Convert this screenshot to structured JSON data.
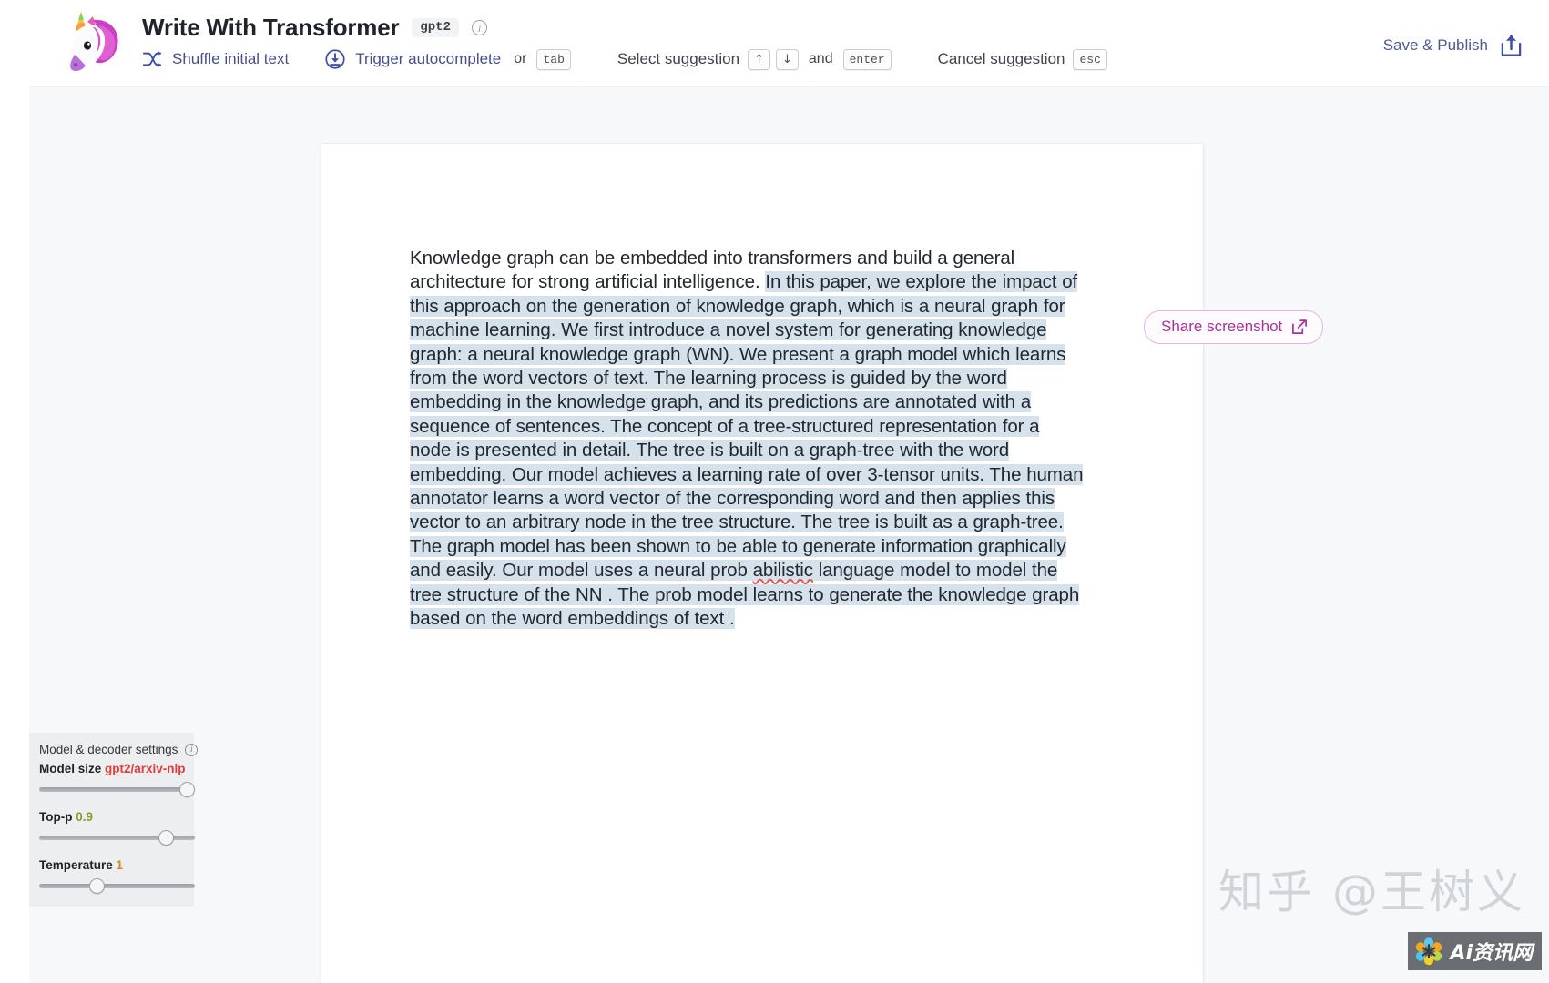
{
  "header": {
    "logo_icon": "unicorn-logo",
    "title": "Write With Transformer",
    "model_badge": "gpt2",
    "info_icon": "info-icon",
    "hints": [
      {
        "icon": "shuffle-icon",
        "label": "Shuffle initial text",
        "keys": []
      },
      {
        "icon": "download-icon",
        "label": "Trigger autocomplete",
        "connector": "or",
        "keys": [
          "tab"
        ]
      },
      {
        "icon": "",
        "label": "Select suggestion",
        "keys": [
          "↑",
          "↓"
        ],
        "connector": "and",
        "keys2": [
          "enter"
        ]
      },
      {
        "icon": "",
        "label": "Cancel suggestion",
        "keys": [
          "esc"
        ]
      }
    ],
    "hint_words": {
      "or": "or",
      "and": "and"
    },
    "save_publish_label": "Save & Publish",
    "save_publish_icon": "upload-icon"
  },
  "share": {
    "label": "Share screenshot",
    "icon": "external-link-icon"
  },
  "document": {
    "prompt_text": "Knowledge graph can be embedded into transformers and build a general architecture for strong artificial intelligence. ",
    "generated_text_part1": "In this paper, we explore the impact of this approach on the generation of knowledge graph, which is a neural graph for machine learning. We first introduce a novel system for generating knowledge graph: a neural knowledge graph (WN).  We present a graph model which learns from the word vectors of text. The learning process is guided by the word embedding in the knowledge graph, and its predictions are annotated with  a sequence of sentences. The concept of a tree-structured representation for a node is presented in detail. The tree is built on a graph-tree with the word embedding. Our model achieves a learning rate of over 3-tensor units. The human annotator learns a word vector of the corresponding  word and then applies this vector to an arbitrary node in the tree structure. The tree is built as a graph-tree. The graph model has been shown to be able to generate information graphically and easily. Our model uses a neural prob ",
    "misspelled_word": "abilistic",
    "generated_text_part2": " language model to model the tree structure of the NN . The prob model learns  to generate the knowledge graph based on the word embeddings of text .",
    "highlight_color": "#d5e2ec"
  },
  "settings": {
    "title": "Model & decoder settings",
    "info_icon": "info-icon",
    "controls": [
      {
        "name": "model-size",
        "label": "Model size",
        "value": "gpt2/arxiv-nlp",
        "value_color": "#e23b3b",
        "thumb_percent": 100
      },
      {
        "name": "top-p",
        "label": "Top-p",
        "value": "0.9",
        "value_color": "#83a024",
        "thumb_percent": 85
      },
      {
        "name": "temperature",
        "label": "Temperature",
        "value": "1",
        "value_color": "#d98324",
        "thumb_percent": 34
      }
    ]
  },
  "watermark": {
    "text": "知乎 @王树义",
    "badge_text": "Ai资讯网",
    "badge_icon": "flower-icon"
  }
}
